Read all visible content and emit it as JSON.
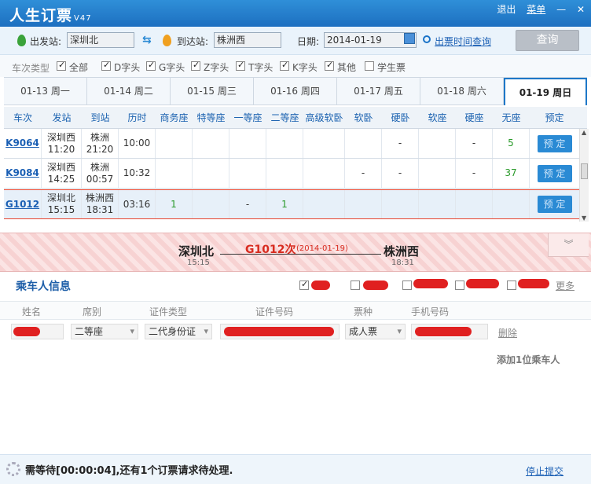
{
  "app": {
    "title": "人生订票",
    "version": "V47"
  },
  "window": {
    "logout": "退出",
    "menu": "菜单",
    "minimize": "—",
    "close": "✕"
  },
  "search": {
    "from_label": "出发站:",
    "from_value": "深圳北",
    "to_label": "到达站:",
    "to_value": "株洲西",
    "date_label": "日期:",
    "date_value": "2014-01-19",
    "timetable_link": "出票时间查询",
    "query_button": "查询"
  },
  "train_types": {
    "label": "车次类型",
    "options": [
      {
        "label": "全部",
        "checked": true
      },
      {
        "label": "D字头",
        "checked": true
      },
      {
        "label": "G字头",
        "checked": true
      },
      {
        "label": "Z字头",
        "checked": true
      },
      {
        "label": "T字头",
        "checked": true
      },
      {
        "label": "K字头",
        "checked": true
      },
      {
        "label": "其他",
        "checked": true
      },
      {
        "label": "学生票",
        "checked": false
      }
    ]
  },
  "date_tabs": [
    {
      "label": "01-13 周一"
    },
    {
      "label": "01-14 周二"
    },
    {
      "label": "01-15 周三"
    },
    {
      "label": "01-16 周四"
    },
    {
      "label": "01-17 周五"
    },
    {
      "label": "01-18 周六"
    },
    {
      "label": "01-19 周日",
      "active": true
    }
  ],
  "table": {
    "headers": [
      "车次",
      "发站",
      "到站",
      "历时",
      "商务座",
      "特等座",
      "一等座",
      "二等座",
      "高级软卧",
      "软卧",
      "硬卧",
      "软座",
      "硬座",
      "无座",
      "预定"
    ],
    "rows": [
      {
        "train": "K9064",
        "from": "深圳西",
        "dep": "11:20",
        "to": "株洲",
        "arr": "21:20",
        "duration": "10:00",
        "seats": [
          "",
          "",
          "",
          "",
          "",
          "",
          "-",
          "",
          "-",
          "5"
        ],
        "book": "预 定"
      },
      {
        "train": "K9084",
        "from": "深圳西",
        "dep": "14:25",
        "to": "株洲",
        "arr": "00:57",
        "duration": "10:32",
        "seats": [
          "",
          "",
          "",
          "",
          "",
          "-",
          "-",
          "",
          "-",
          "37"
        ],
        "book": "预 定"
      },
      {
        "train": "G1012",
        "from": "深圳北",
        "dep": "15:15",
        "to": "株洲西",
        "arr": "18:31",
        "duration": "03:16",
        "seats": [
          "1",
          "",
          "-",
          "1",
          "",
          "",
          "",
          "",
          "",
          ""
        ],
        "book": "预 定"
      }
    ]
  },
  "selected_train": {
    "from": "深圳北",
    "dep_time": "15:15",
    "train": "G1012次",
    "date": "(2014-01-19)",
    "to": "株洲西",
    "arr_time": "18:31",
    "collapse": "︾"
  },
  "passengers": {
    "title": "乘车人信息",
    "more": "更多",
    "columns": [
      "姓名",
      "席别",
      "证件类型",
      "证件号码",
      "票种",
      "手机号码"
    ],
    "row": {
      "seat": "二等座",
      "id_type": "二代身份证",
      "ticket_type": "成人票",
      "delete": "删除"
    },
    "add": "添加1位乘车人"
  },
  "status": {
    "text": "需等待[00:00:04],还有1个订票请求待处理.",
    "stop": "停止提交"
  },
  "colors": {
    "accent": "#2a8ad4",
    "title_bar": "#1d6fc0",
    "highlight": "#d82c20"
  }
}
